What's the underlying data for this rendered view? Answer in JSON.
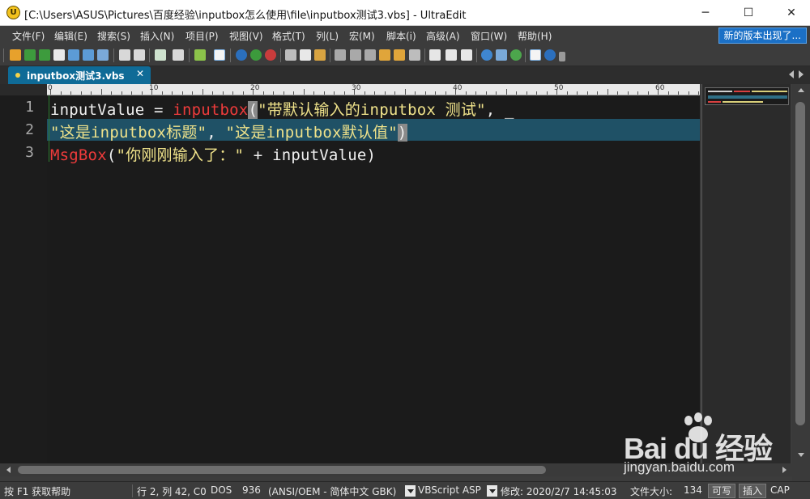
{
  "window": {
    "title": "[C:\\Users\\ASUS\\Pictures\\百度经验\\inputbox怎么使用\\file\\inputbox测试3.vbs] - UltraEdit",
    "app_icon_text": "U",
    "minimize": "─",
    "maximize": "☐",
    "close": "✕"
  },
  "menu": {
    "items": [
      "文件(F)",
      "编辑(E)",
      "搜索(S)",
      "插入(N)",
      "项目(P)",
      "视图(V)",
      "格式(T)",
      "列(L)",
      "宏(M)",
      "脚本(i)",
      "高级(A)",
      "窗口(W)",
      "帮助(H)"
    ],
    "update_notice": "新的版本出现了..."
  },
  "tab": {
    "label": "inputbox测试3.vbs",
    "close": "✕"
  },
  "ruler": {
    "labels": [
      "0",
      "10",
      "20",
      "30",
      "40",
      "50",
      "60"
    ]
  },
  "editor": {
    "line_numbers": [
      "1",
      "2",
      "3"
    ],
    "lines": [
      [
        {
          "t": "inputValue = ",
          "c": "t-id"
        },
        {
          "t": "inputbox",
          "c": "t-fn"
        },
        {
          "t": "(",
          "c": "t-br"
        },
        {
          "t": "\"带默认输入的inputbox 测试\"",
          "c": "t-str"
        },
        {
          "t": ", _",
          "c": "t-op"
        }
      ],
      [
        {
          "t": "\"这是inputbox标题\"",
          "c": "t-str"
        },
        {
          "t": ", ",
          "c": "t-op"
        },
        {
          "t": "\"这是inputbox默认值\"",
          "c": "t-str"
        },
        {
          "t": ")",
          "c": "t-br"
        }
      ],
      [
        {
          "t": "MsgBox",
          "c": "t-fn"
        },
        {
          "t": "(",
          "c": "t-op"
        },
        {
          "t": "\"你刚刚输入了：\"",
          "c": "t-str"
        },
        {
          "t": " + inputValue)",
          "c": "t-id"
        }
      ]
    ]
  },
  "statusbar": {
    "help": "按 F1 获取帮助",
    "position": "行 2, 列 42, C0",
    "line_ending": "DOS",
    "codepage": "936",
    "encoding": "(ANSI/OEM - 简体中文 GBK)",
    "syntax": "VBScript ASP",
    "modified": "修改:   2020/2/7 14:45:03",
    "filesize_label": "文件大小:",
    "filesize": "134",
    "writable": "可写",
    "insert_mode": "插入",
    "caps": "CAP"
  },
  "watermark": {
    "logo": "Bai du 经验",
    "url": "jingyan.baidu.com"
  },
  "colors": {
    "tab_active": "#0f6b97",
    "current_line": "#1f5166",
    "keyword_function": "#ee3b3b",
    "string": "#efe28a",
    "notice_button": "#1b70c6"
  }
}
